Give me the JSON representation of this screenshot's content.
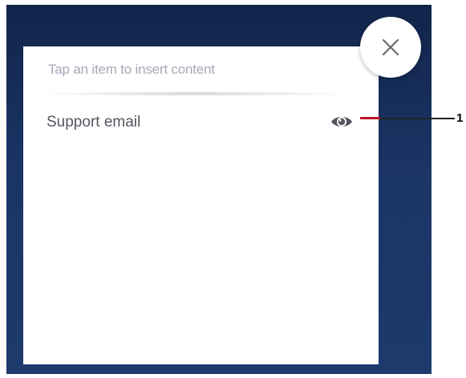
{
  "panel": {
    "hint": "Tap an item to insert content",
    "items": [
      {
        "label": "Support email",
        "action_icon": "eye-icon"
      }
    ]
  },
  "close_button": {
    "icon": "close-icon"
  },
  "callout": {
    "number": "1"
  },
  "colors": {
    "backdrop": "#1a3566",
    "panel": "#ffffff",
    "hint_text": "#a7a7b8",
    "item_text": "#55555f",
    "callout_accent": "#b8142a"
  }
}
